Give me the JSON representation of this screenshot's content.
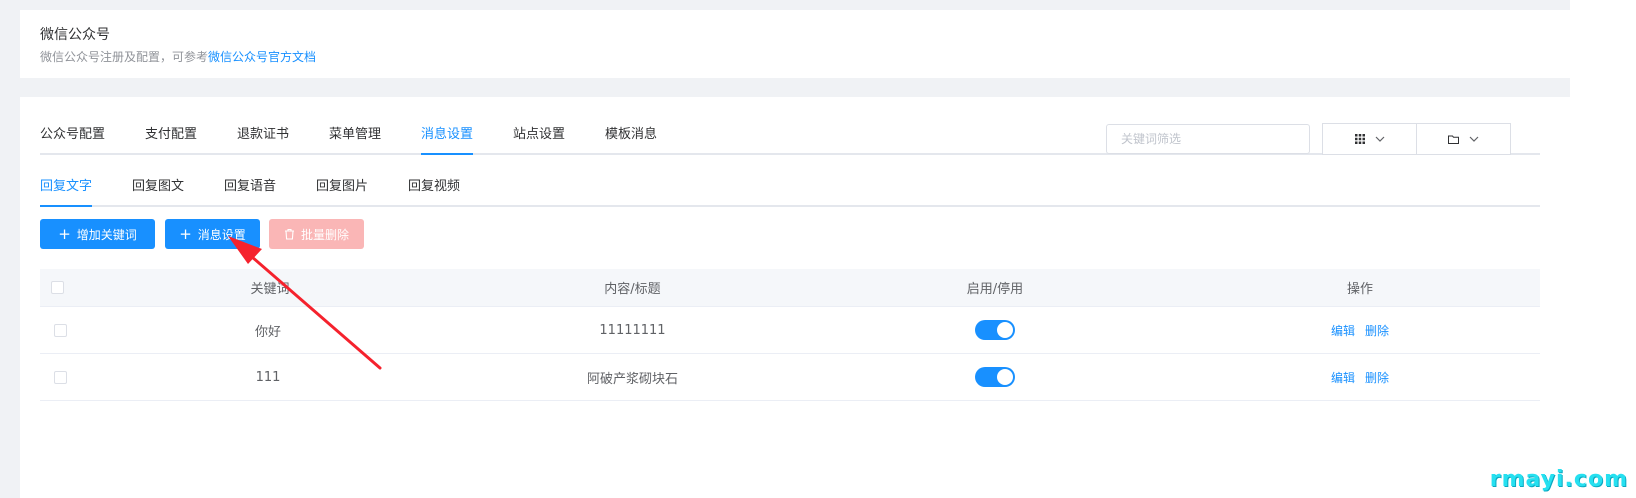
{
  "header": {
    "title": "微信公众号",
    "description": "微信公众号注册及配置，可参考",
    "doc_link": "微信公众号官方文档"
  },
  "main_tabs": [
    {
      "label": "公众号配置",
      "active": false
    },
    {
      "label": "支付配置",
      "active": false
    },
    {
      "label": "退款证书",
      "active": false
    },
    {
      "label": "菜单管理",
      "active": false
    },
    {
      "label": "消息设置",
      "active": true
    },
    {
      "label": "站点设置",
      "active": false
    },
    {
      "label": "模板消息",
      "active": false
    }
  ],
  "sub_tabs": [
    {
      "label": "回复文字",
      "active": true
    },
    {
      "label": "回复图文",
      "active": false
    },
    {
      "label": "回复语音",
      "active": false
    },
    {
      "label": "回复图片",
      "active": false
    },
    {
      "label": "回复视频",
      "active": false
    }
  ],
  "toolbar": {
    "add_keyword_label": "增加关键词",
    "message_settings_label": "消息设置",
    "batch_delete_label": "批量删除",
    "filter_placeholder": "关键词筛选",
    "view_icon": "grid-icon",
    "folder_icon": "folder-icon"
  },
  "table": {
    "columns": [
      "关键词",
      "内容/标题",
      "启用/停用",
      "操作"
    ],
    "rows": [
      {
        "keyword": "你好",
        "content": "11111111",
        "enabled": true,
        "edit": "编辑",
        "delete": "删除"
      },
      {
        "keyword": "111",
        "content": "阿破产浆砌块石",
        "enabled": true,
        "edit": "编辑",
        "delete": "删除"
      }
    ]
  },
  "colors": {
    "primary": "#1890ff",
    "danger_disabled": "#fab6b6",
    "annotation_arrow": "#f5222d"
  },
  "watermark": "rmayi.com"
}
